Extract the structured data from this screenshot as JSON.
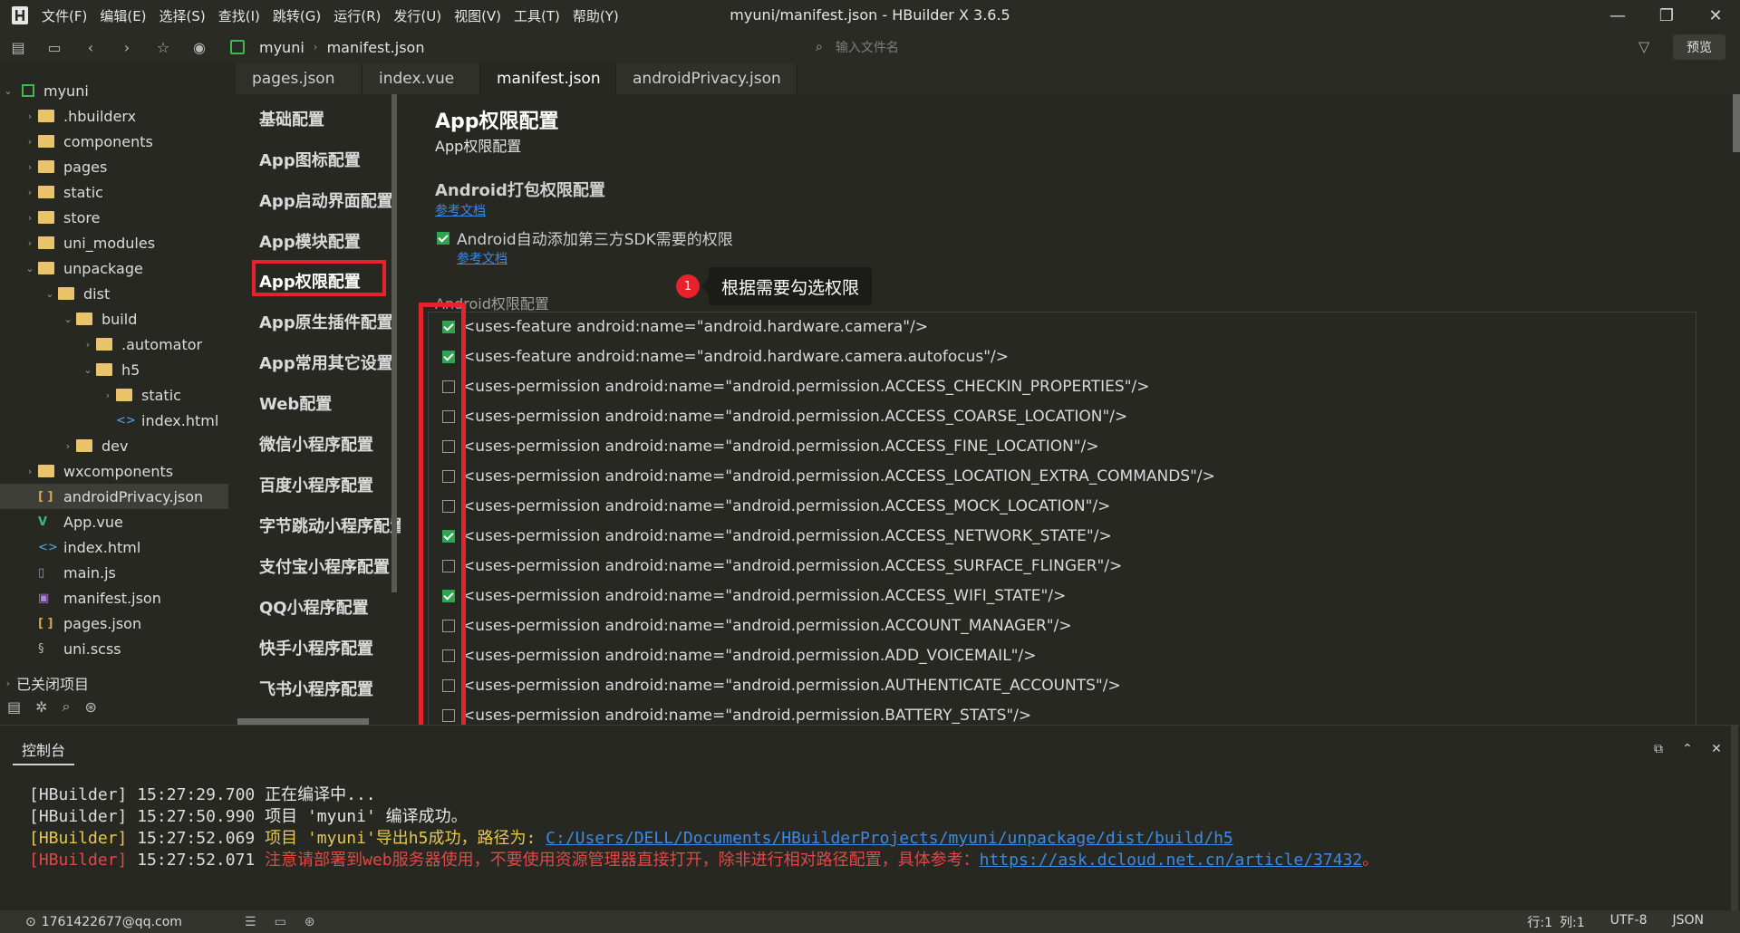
{
  "titlebar": {
    "menu": [
      "文件(F)",
      "编辑(E)",
      "选择(S)",
      "查找(I)",
      "跳转(G)",
      "运行(R)",
      "发行(U)",
      "视图(V)",
      "工具(T)",
      "帮助(Y)"
    ],
    "window_title": "myuni/manifest.json - HBuilder X 3.6.5"
  },
  "toolbar": {
    "crumbs": [
      "myuni",
      "manifest.json"
    ],
    "file_search_placeholder": "输入文件名",
    "preview_label": "预览"
  },
  "tree": {
    "items": [
      {
        "label": "myuni",
        "type": "project"
      },
      {
        "label": ".hbuilderx",
        "type": "folder"
      },
      {
        "label": "components",
        "type": "folder"
      },
      {
        "label": "pages",
        "type": "folder"
      },
      {
        "label": "static",
        "type": "folder"
      },
      {
        "label": "store",
        "type": "folder"
      },
      {
        "label": "uni_modules",
        "type": "folder"
      },
      {
        "label": "unpackage",
        "type": "folder"
      },
      {
        "label": "dist",
        "type": "folder"
      },
      {
        "label": "build",
        "type": "folder"
      },
      {
        "label": ".automator",
        "type": "folder"
      },
      {
        "label": "h5",
        "type": "folder"
      },
      {
        "label": "static",
        "type": "folder"
      },
      {
        "label": "index.html",
        "type": "html"
      },
      {
        "label": "dev",
        "type": "folder"
      },
      {
        "label": "wxcomponents",
        "type": "folder"
      },
      {
        "label": "androidPrivacy.json",
        "type": "json"
      },
      {
        "label": "App.vue",
        "type": "vue"
      },
      {
        "label": "index.html",
        "type": "html"
      },
      {
        "label": "main.js",
        "type": "js"
      },
      {
        "label": "manifest.json",
        "type": "manifest"
      },
      {
        "label": "pages.json",
        "type": "json"
      },
      {
        "label": "uni.scss",
        "type": "scss"
      }
    ],
    "closed_projects": "已关闭项目"
  },
  "tabs": [
    "pages.json",
    "index.vue",
    "manifest.json",
    "androidPrivacy.json"
  ],
  "confnav": {
    "items": [
      "基础配置",
      "App图标配置",
      "App启动界面配置",
      "App模块配置",
      "App权限配置",
      "App原生插件配置",
      "App常用其它设置",
      "Web配置",
      "微信小程序配置",
      "百度小程序配置",
      "字节跳动小程序配置",
      "支付宝小程序配置",
      "QQ小程序配置",
      "快手小程序配置",
      "飞书小程序配置"
    ]
  },
  "content": {
    "title": "App权限配置",
    "subtitle": "App权限配置",
    "android_section": "Android打包权限配置",
    "doc_link": "参考文档",
    "auto_add_label": "Android自动添加第三方SDK需要的权限",
    "auto_add_checked": true,
    "doc_link2": "参考文档",
    "perm_label": "Android权限配置",
    "badge": "1",
    "tooltip": "根据需要勾选权限",
    "permissions": [
      {
        "text": "<uses-feature android:name=\"android.hardware.camera\"/>",
        "checked": true
      },
      {
        "text": "<uses-feature android:name=\"android.hardware.camera.autofocus\"/>",
        "checked": true
      },
      {
        "text": "<uses-permission android:name=\"android.permission.ACCESS_CHECKIN_PROPERTIES\"/>",
        "checked": false
      },
      {
        "text": "<uses-permission android:name=\"android.permission.ACCESS_COARSE_LOCATION\"/>",
        "checked": false
      },
      {
        "text": "<uses-permission android:name=\"android.permission.ACCESS_FINE_LOCATION\"/>",
        "checked": false
      },
      {
        "text": "<uses-permission android:name=\"android.permission.ACCESS_LOCATION_EXTRA_COMMANDS\"/>",
        "checked": false
      },
      {
        "text": "<uses-permission android:name=\"android.permission.ACCESS_MOCK_LOCATION\"/>",
        "checked": false
      },
      {
        "text": "<uses-permission android:name=\"android.permission.ACCESS_NETWORK_STATE\"/>",
        "checked": true
      },
      {
        "text": "<uses-permission android:name=\"android.permission.ACCESS_SURFACE_FLINGER\"/>",
        "checked": false
      },
      {
        "text": "<uses-permission android:name=\"android.permission.ACCESS_WIFI_STATE\"/>",
        "checked": true
      },
      {
        "text": "<uses-permission android:name=\"android.permission.ACCOUNT_MANAGER\"/>",
        "checked": false
      },
      {
        "text": "<uses-permission android:name=\"android.permission.ADD_VOICEMAIL\"/>",
        "checked": false
      },
      {
        "text": "<uses-permission android:name=\"android.permission.AUTHENTICATE_ACCOUNTS\"/>",
        "checked": false
      },
      {
        "text": "<uses-permission android:name=\"android.permission.BATTERY_STATS\"/>",
        "checked": false
      }
    ]
  },
  "console": {
    "tab": "控制台",
    "logs": [
      {
        "tag": "[HBuilder]",
        "time": "15:27:29.700",
        "msg": "正在编译中..."
      },
      {
        "tag": "[HBuilder]",
        "time": "15:27:50.990",
        "msg": "项目 'myuni' 编译成功。"
      },
      {
        "tag": "[HBuilder]",
        "time": "15:27:52.069",
        "msg": "项目 'myuni'导出h5成功，路径为:",
        "link": "C:/Users/DELL/Documents/HBuilderProjects/myuni/unpackage/dist/build/h5"
      },
      {
        "tag": "[HBuilder]",
        "time": "15:27:52.071",
        "msg": "注意请部署到web服务器使用，不要使用资源管理器直接打开，除非进行相对路径配置，具体参考：",
        "link": "https://ask.dcloud.net.cn/article/37432",
        "suffix": "。"
      }
    ]
  },
  "status": {
    "user": "1761422677@qq.com",
    "line": "行:1",
    "col": "列:1",
    "encoding": "UTF-8",
    "lang": "JSON"
  }
}
